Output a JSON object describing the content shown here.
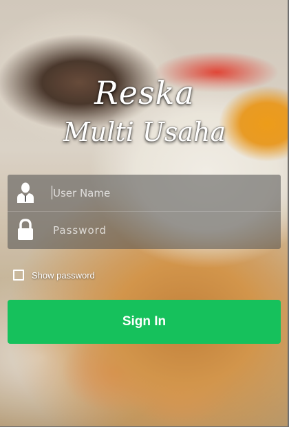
{
  "brand": {
    "line1": "Reska",
    "line2": "Multi Usaha"
  },
  "login_form": {
    "username": {
      "placeholder": "User Name",
      "value": "",
      "icon": "user-icon"
    },
    "password": {
      "placeholder": "Password",
      "value": "",
      "icon": "lock-icon"
    }
  },
  "show_password": {
    "label": "Show password",
    "checked": false
  },
  "sign_in": {
    "label": "Sign In",
    "color": "#16c15c"
  }
}
